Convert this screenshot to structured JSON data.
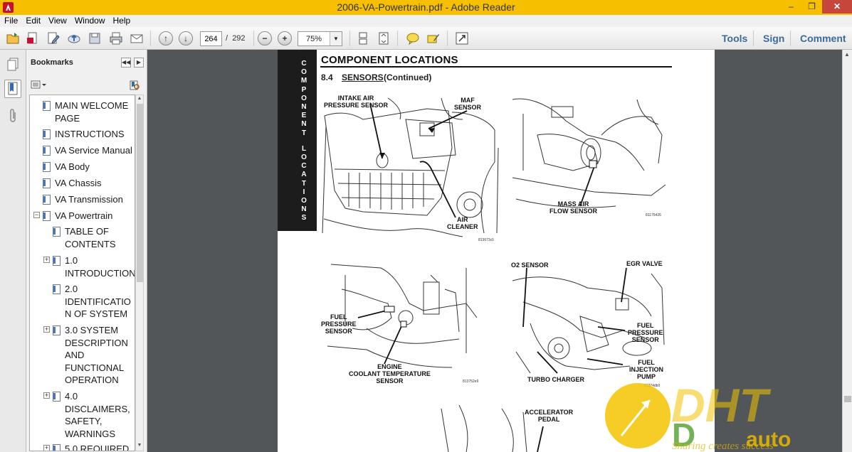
{
  "window": {
    "title": "2006-VA-Powertrain.pdf - Adobe Reader",
    "minimize": "–",
    "maximize": "❐",
    "close": "✕"
  },
  "menu": [
    "File",
    "Edit",
    "View",
    "Window",
    "Help"
  ],
  "toolbar": {
    "page_current": "264",
    "page_separator": "/",
    "page_total": "292",
    "zoom": "75%",
    "links": {
      "tools": "Tools",
      "sign": "Sign",
      "comment": "Comment"
    }
  },
  "bookmarks": {
    "title": "Bookmarks",
    "items": [
      {
        "label": "MAIN WELCOME PAGE",
        "lines": [
          "MAIN WELCOME",
          "PAGE"
        ]
      },
      {
        "label": "INSTRUCTIONS",
        "lines": [
          "INSTRUCTIONS"
        ]
      },
      {
        "label": "VA Service Manual",
        "lines": [
          "VA Service Manual"
        ]
      },
      {
        "label": "VA Body",
        "lines": [
          "VA Body"
        ]
      },
      {
        "label": "VA Chassis",
        "lines": [
          "VA Chassis"
        ]
      },
      {
        "label": "VA Transmission",
        "lines": [
          "VA Transmission"
        ]
      },
      {
        "label": "VA Powertrain",
        "lines": [
          "VA Powertrain"
        ]
      },
      {
        "label": "TABLE OF CONTENTS",
        "lines": [
          "TABLE OF",
          "CONTENTS"
        ]
      },
      {
        "label": "1.0 INTRODUCTION",
        "lines": [
          "1.0",
          "INTRODUCTION"
        ]
      },
      {
        "label": "2.0 IDENTIFICATION OF SYSTEM",
        "lines": [
          "2.0",
          "IDENTIFICATIO",
          "N OF SYSTEM"
        ]
      },
      {
        "label": "3.0 SYSTEM DESCRIPTION AND FUNCTIONAL OPERATION",
        "lines": [
          "3.0 SYSTEM",
          "DESCRIPTION",
          "AND",
          "FUNCTIONAL",
          "OPERATION"
        ]
      },
      {
        "label": "4.0 DISCLAIMERS, SAFETY, WARNINGS",
        "lines": [
          "4.0",
          "DISCLAIMERS,",
          "SAFETY,",
          "WARNINGS"
        ]
      },
      {
        "label": "5.0 REQUIRED",
        "lines": [
          "5.0 REQUIRED"
        ]
      }
    ]
  },
  "document": {
    "side_tab_words": [
      "COMPONENT",
      "LOCATIONS"
    ],
    "heading": "COMPONENT LOCATIONS",
    "section_number": "8.4",
    "section_name": "SENSORS",
    "section_suffix": "(Continued)",
    "figures": [
      {
        "labels": [
          "INTAKE AIR\nPRESSURE SENSOR",
          "MAF\nSENSOR",
          "AIR\nCLEANER"
        ],
        "id": "813673c5"
      },
      {
        "labels": [
          "MASS AIR\nFLOW SENSOR"
        ],
        "id": "81175426"
      },
      {
        "labels": [
          "FUEL\nPRESSURE\nSENSOR",
          "ENGINE\nCOOLANT TEMPERATURE\nSENSOR"
        ],
        "id": "813752e9"
      },
      {
        "labels": [
          "O2 SENSOR",
          "EGR VALVE",
          "FUEL\nPRESSURE\nSENSOR",
          "FUEL\nINJECTION\nPUMP",
          "TURBO CHARGER"
        ],
        "id": "81374db0"
      },
      {
        "labels": [
          "ACCELERATOR\nPEDAL"
        ],
        "id": ""
      }
    ]
  },
  "watermark": {
    "brand": "DHT auto",
    "slogan": "Sharing creates success"
  },
  "colors": {
    "titlebar": "#f6c000",
    "link": "#3c6a9c",
    "doc_bg": "#525659"
  }
}
